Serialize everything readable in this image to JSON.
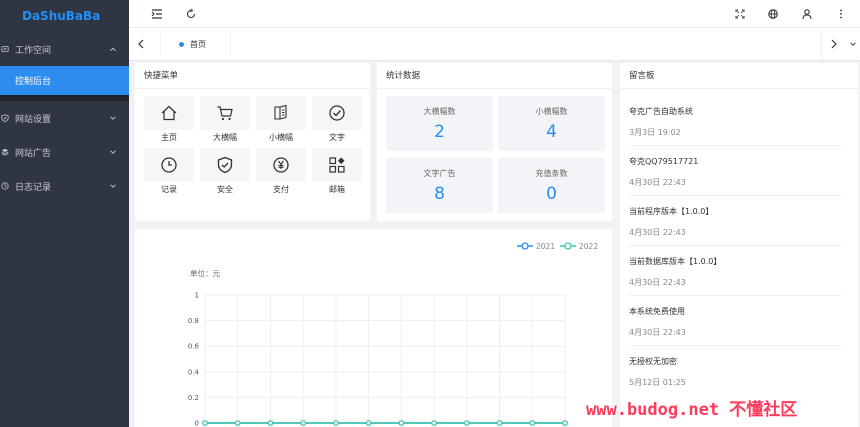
{
  "app": {
    "logo": "DaShuBaBa"
  },
  "sidebar": {
    "items": [
      {
        "label": "工作空间",
        "icon": "dashboard-icon",
        "expanded": true
      },
      {
        "label": "网站设置",
        "icon": "shield-icon",
        "expanded": false
      },
      {
        "label": "网站广告",
        "icon": "layers-icon",
        "expanded": false
      },
      {
        "label": "日志记录",
        "icon": "clock-icon",
        "expanded": false
      }
    ],
    "active_sub": "控制后台"
  },
  "topbar": {
    "icons": [
      "collapse-menu-icon",
      "refresh-icon",
      "fullscreen-icon",
      "globe-icon",
      "user-icon",
      "more-icon"
    ]
  },
  "tabs": {
    "home_label": "首页"
  },
  "quick_menu": {
    "title": "快捷菜单",
    "items": [
      {
        "label": "主页",
        "icon": "home-icon"
      },
      {
        "label": "大横幅",
        "icon": "cart-icon"
      },
      {
        "label": "小横幅",
        "icon": "book-icon"
      },
      {
        "label": "文字",
        "icon": "check-circle-icon"
      },
      {
        "label": "记录",
        "icon": "clock-icon"
      },
      {
        "label": "安全",
        "icon": "shield-check-icon"
      },
      {
        "label": "支付",
        "icon": "yen-icon"
      },
      {
        "label": "邮箱",
        "icon": "apps-icon"
      }
    ]
  },
  "stats": {
    "title": "统计数据",
    "items": [
      {
        "label": "大横幅数",
        "value": "2"
      },
      {
        "label": "小横幅数",
        "value": "4"
      },
      {
        "label": "文字广告",
        "value": "8"
      },
      {
        "label": "充值条数",
        "value": "0"
      }
    ]
  },
  "board": {
    "title": "留言板",
    "messages": [
      {
        "title": "夸克广告自助系统",
        "time": "3月3日 19:02"
      },
      {
        "title": "夸克QQ79517721",
        "time": "4月30日 22:43"
      },
      {
        "title": "当前程序版本【1.0.0】",
        "time": "4月30日 22:43"
      },
      {
        "title": "当前数据库版本【1.0.0】",
        "time": "4月30日 22:43"
      },
      {
        "title": "本系统免费使用",
        "time": "4月30日 22:43"
      },
      {
        "title": "无授权无加密",
        "time": "5月12日 01:25"
      }
    ]
  },
  "watermark": "www.budog.net 不懂社区",
  "chart_data": {
    "type": "line",
    "ylabel": "单位：元",
    "ylim": [
      0,
      1
    ],
    "yticks": [
      "0",
      "0.2",
      "0.4",
      "0.6",
      "0.8",
      "1"
    ],
    "grid": true,
    "legend_position": "top-right",
    "series": [
      {
        "name": "2021",
        "color": "#2d8cf0",
        "values": [
          0,
          0,
          0,
          0,
          0,
          0,
          0,
          0,
          0,
          0,
          0,
          0
        ]
      },
      {
        "name": "2022",
        "color": "#3cc8a6",
        "values": [
          0,
          0,
          0,
          0,
          0,
          0,
          0,
          0,
          0,
          0,
          0,
          0
        ]
      }
    ]
  }
}
